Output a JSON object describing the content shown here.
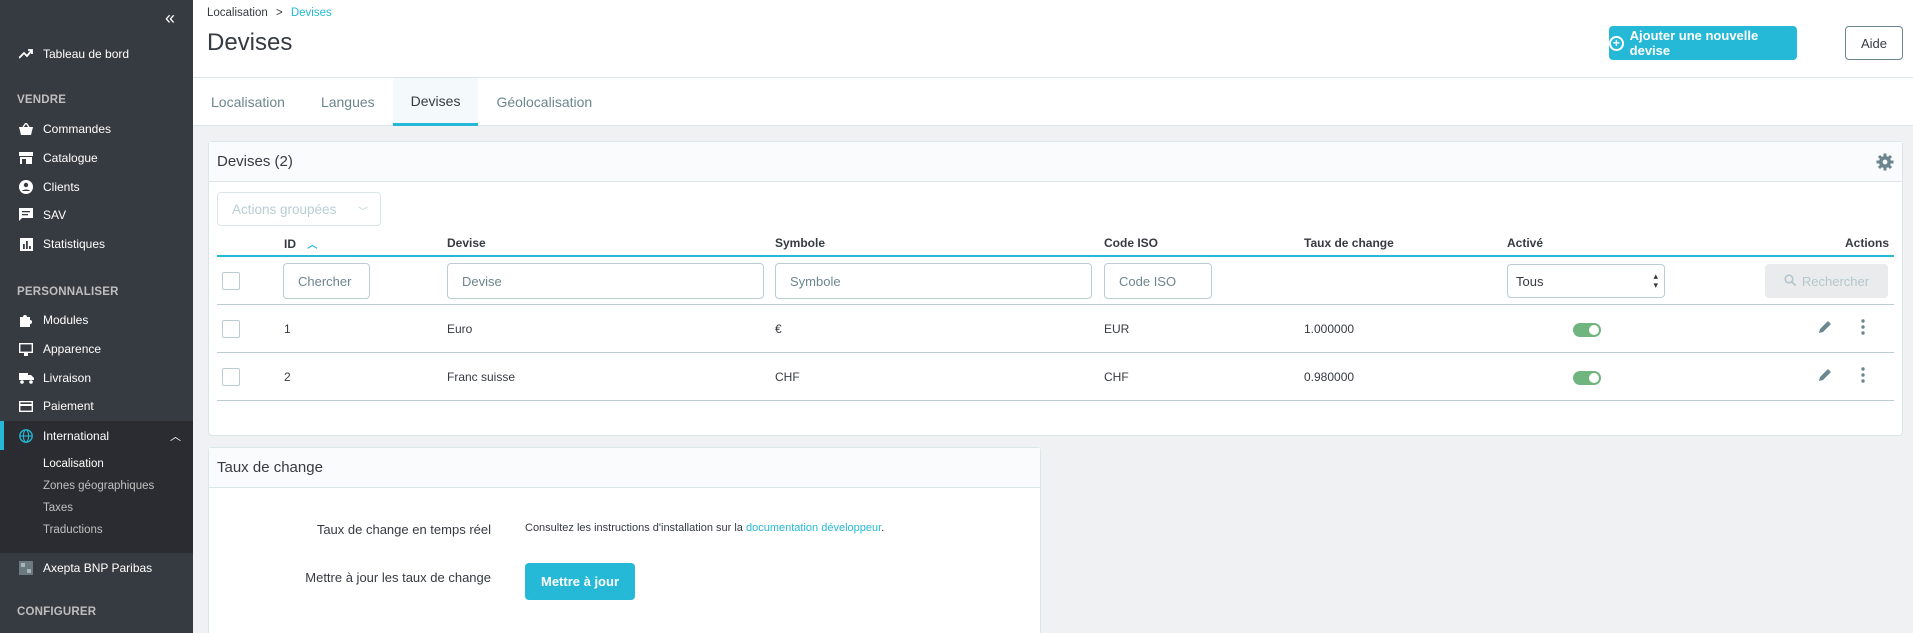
{
  "sidebar": {
    "dashboard": "Tableau de bord",
    "sections": {
      "sell": "VENDRE",
      "customize": "PERSONNALISER",
      "configure": "CONFIGURER"
    },
    "sell_items": [
      "Commandes",
      "Catalogue",
      "Clients",
      "SAV",
      "Statistiques"
    ],
    "customize_items": [
      "Modules",
      "Apparence",
      "Livraison",
      "Paiement",
      "International"
    ],
    "submenu": [
      "Localisation",
      "Zones géographiques",
      "Taxes",
      "Traductions"
    ],
    "extra_item": "Axepta BNP Paribas"
  },
  "header": {
    "breadcrumb_parent": "Localisation",
    "breadcrumb_sep": ">",
    "breadcrumb_current": "Devises",
    "title": "Devises",
    "add_button": "Ajouter une nouvelle devise",
    "help_button": "Aide",
    "tabs": [
      "Localisation",
      "Langues",
      "Devises",
      "Géolocalisation"
    ],
    "active_tab": "Devises"
  },
  "grid": {
    "title": "Devises (2)",
    "bulk_actions": "Actions groupées",
    "columns": {
      "id": "ID",
      "currency": "Devise",
      "symbol": "Symbole",
      "iso": "Code ISO",
      "rate": "Taux de change",
      "enabled": "Activé",
      "actions": "Actions"
    },
    "filters": {
      "id_placeholder": "Chercher",
      "currency_placeholder": "Devise",
      "symbol_placeholder": "Symbole",
      "iso_placeholder": "Code ISO",
      "enabled_value": "Tous",
      "search_button": "Rechercher"
    },
    "rows": [
      {
        "id": "1",
        "currency": "Euro",
        "symbol": "€",
        "iso": "EUR",
        "rate": "1.000000",
        "enabled": true
      },
      {
        "id": "2",
        "currency": "Franc suisse",
        "symbol": "CHF",
        "iso": "CHF",
        "rate": "0.980000",
        "enabled": true
      }
    ]
  },
  "exchange": {
    "title": "Taux de change",
    "live_label": "Taux de change en temps réel",
    "live_text": "Consultez les instructions d'installation sur la",
    "live_link": "documentation développeur",
    "live_text_end": ".",
    "update_label": "Mettre à jour les taux de change",
    "update_button": "Mettre à jour"
  },
  "colors": {
    "accent": "#25b9d7",
    "sidebar": "#363a41",
    "toggle_on": "#70b580"
  }
}
